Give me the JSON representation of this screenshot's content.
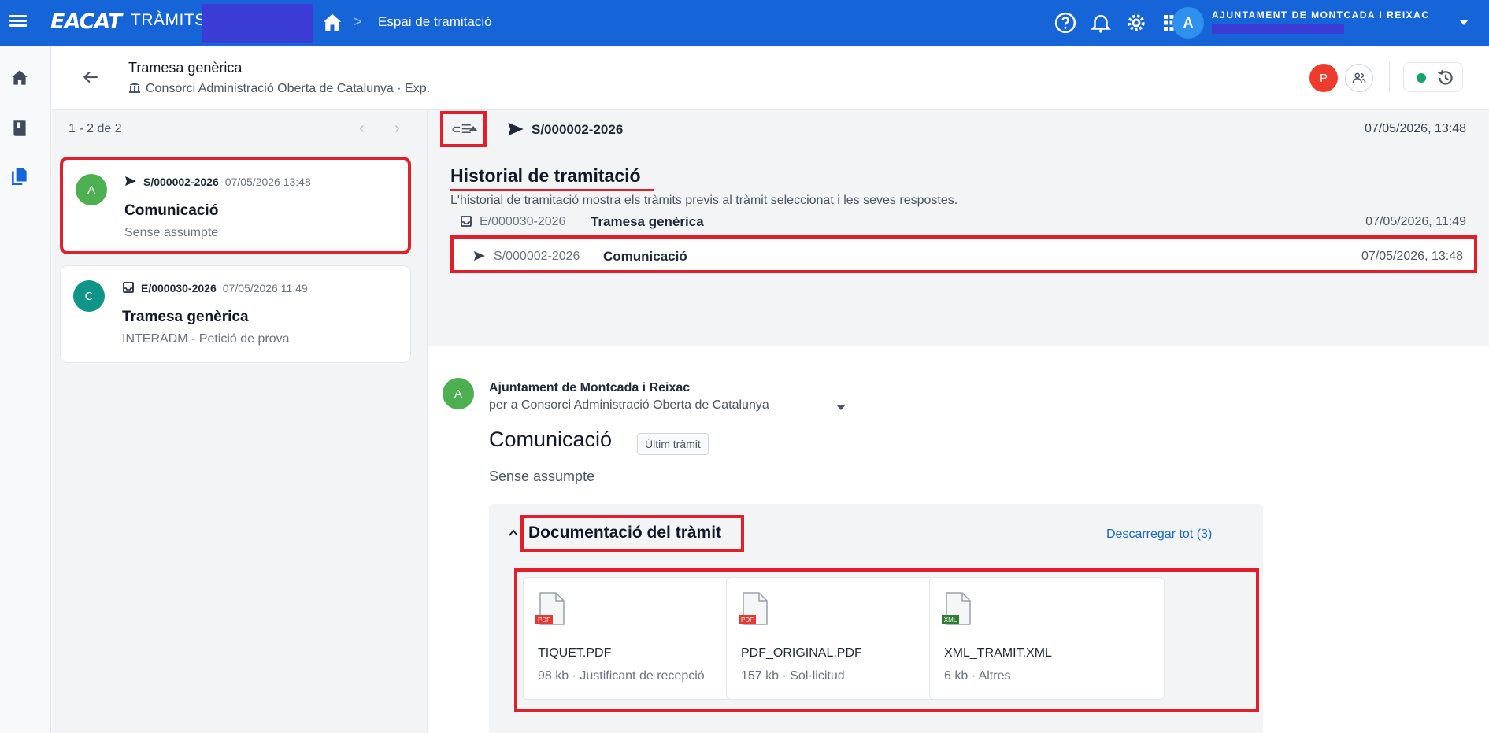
{
  "topbar": {
    "brand": "EACAT",
    "product": "TRÀMITS",
    "breadcrumb_separator": ">",
    "breadcrumb": "Espai de tramitació",
    "user_initial": "A",
    "organization": "AJUNTAMENT DE MONTCADA I REIXAC",
    "bg_color": "#1565d8"
  },
  "rail": {
    "icons": [
      "home-icon",
      "book-icon",
      "documents-icon"
    ]
  },
  "header": {
    "title": "Tramesa genèrica",
    "subtitle": "Consorci Administració Oberta de Catalunya · Exp.",
    "participant_initial": "P",
    "more": "···"
  },
  "list": {
    "pager": "1 - 2 de 2",
    "prev": "‹",
    "next": "›",
    "items": [
      {
        "initial": "A",
        "code": "S/000002-2026",
        "date": "07/05/2026 13:48",
        "title": "Comunicació",
        "subtitle": "Sense assumpte",
        "avatar_color": "#4caf50",
        "icon": "send-icon"
      },
      {
        "initial": "C",
        "code": "E/000030-2026",
        "date": "07/05/2026 11:49",
        "title": "Tramesa genèrica",
        "subtitle": "INTERADM - Petició de prova",
        "avatar_color": "#0f9488",
        "icon": "inbox-icon"
      }
    ]
  },
  "detail": {
    "toolbar_code": "S/000002-2026",
    "toolbar_date": "07/05/2026, 13:48",
    "toggle_glyph": "⊂☰",
    "history": {
      "title": "Historial de tramitació",
      "description": "L'historial de tramitació mostra els tràmits previs al tràmit seleccionat i les seves respostes.",
      "rows": [
        {
          "code": "E/000030-2026",
          "name": "Tramesa genèrica",
          "date": "07/05/2026, 11:49"
        },
        {
          "code": "S/000002-2026",
          "name": "Comunicació",
          "date": "07/05/2026, 13:48"
        }
      ]
    },
    "sender": {
      "initial": "A",
      "name": "Ajuntament de Montcada i Reixac",
      "recipient": "per a Consorci Administració Oberta de Catalunya"
    },
    "communication": {
      "title": "Comunicació",
      "badge": "Últim tràmit",
      "subject": "Sense assumpte"
    },
    "documents": {
      "title": "Documentació del tràmit",
      "download_all": "Descarregar tot (3)",
      "files": [
        {
          "name": "TIQUET.PDF",
          "meta": "98 kb · Justificant de recepció",
          "type": "PDF",
          "type_color": "#e53935"
        },
        {
          "name": "PDF_ORIGINAL.PDF",
          "meta": "157 kb · Sol·licitud",
          "type": "PDF",
          "type_color": "#e53935"
        },
        {
          "name": "XML_TRAMIT.XML",
          "meta": "6 kb · Altres",
          "type": "XML",
          "type_color": "#2e7d32"
        }
      ]
    }
  }
}
